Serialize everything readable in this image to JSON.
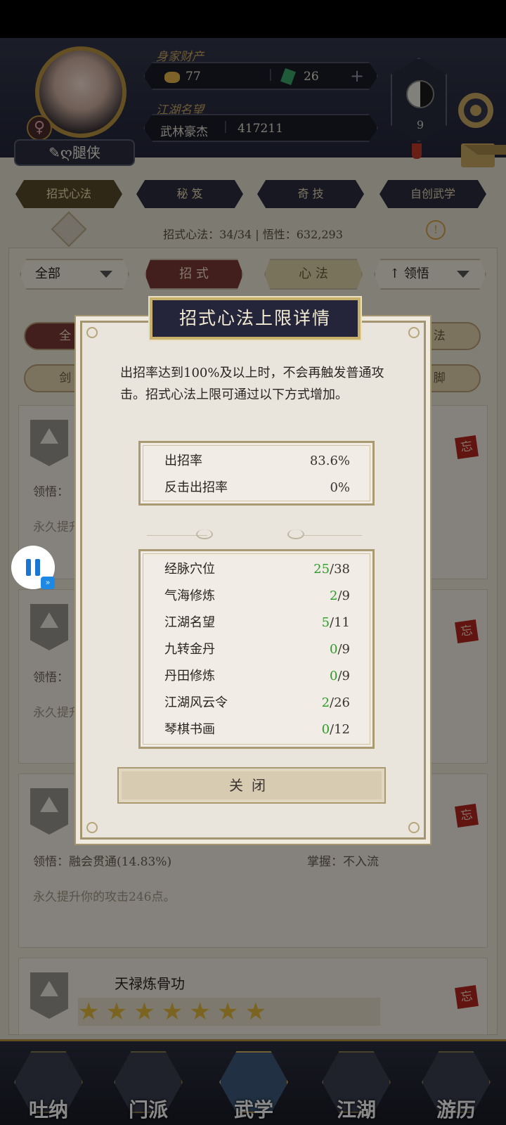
{
  "header": {
    "player_name": "✎ღ腿侠",
    "gender_symbol": "♀",
    "wealth_label": "身家财产",
    "gold": "77",
    "jade": "26",
    "add_symbol": "+",
    "fame_label": "江湖名望",
    "fame_title": "武林豪杰",
    "fame_value": "417211",
    "taiji_level": "9"
  },
  "tabs": [
    "招式心法",
    "秘 笈",
    "奇 技",
    "自创武学"
  ],
  "stats_line": "招式心法：34/34  |  悟性：632,293",
  "warn_symbol": "!",
  "filters": {
    "all": "全部",
    "moves": "招 式",
    "mind": "心 法",
    "sort": "↑ 领悟"
  },
  "pills": [
    "全 部",
    "刀 法",
    "剑 法",
    "腿 脚"
  ],
  "cards": [
    {
      "label": "领悟：",
      "desc": "永久提升",
      "seal": "忘"
    },
    {
      "label": "领悟：",
      "desc": "永久提升",
      "seal": "忘"
    },
    {
      "label": "领悟：融会贯通(14.83%)",
      "mastery": "掌握：不入流",
      "desc": "永久提升你的攻击246点。",
      "seal": "忘"
    },
    {
      "title": "天禄炼骨功",
      "seal": "忘",
      "stars": [
        "★",
        "★",
        "★",
        "★",
        "★",
        "★",
        "★"
      ]
    }
  ],
  "bottom_nav": [
    "吐纳",
    "门派",
    "武学",
    "江湖",
    "游历"
  ],
  "dialog": {
    "title": "招式心法上限详情",
    "description": "出招率达到100%及以上时，不会再触发普通攻击。招式心法上限可通过以下方式增加。",
    "rates": [
      {
        "label": "出招率",
        "value": "83.6%"
      },
      {
        "label": "反击出招率",
        "value": "0%"
      }
    ],
    "sources": [
      {
        "label": "经脉穴位",
        "current": "25",
        "max": "/38"
      },
      {
        "label": "气海修炼",
        "current": "2",
        "max": "/9"
      },
      {
        "label": "江湖名望",
        "current": "5",
        "max": "/11"
      },
      {
        "label": "九转金丹",
        "current": "0",
        "max": "/9"
      },
      {
        "label": "丹田修炼",
        "current": "0",
        "max": "/9"
      },
      {
        "label": "江湖风云令",
        "current": "2",
        "max": "/26"
      },
      {
        "label": "琴棋书画",
        "current": "0",
        "max": "/12"
      }
    ],
    "close_label": "关闭"
  },
  "colors": {
    "progress_green": "#2f9a2a",
    "dialog_title_bg": "#24253a",
    "accent_gold": "#c9b06a"
  }
}
